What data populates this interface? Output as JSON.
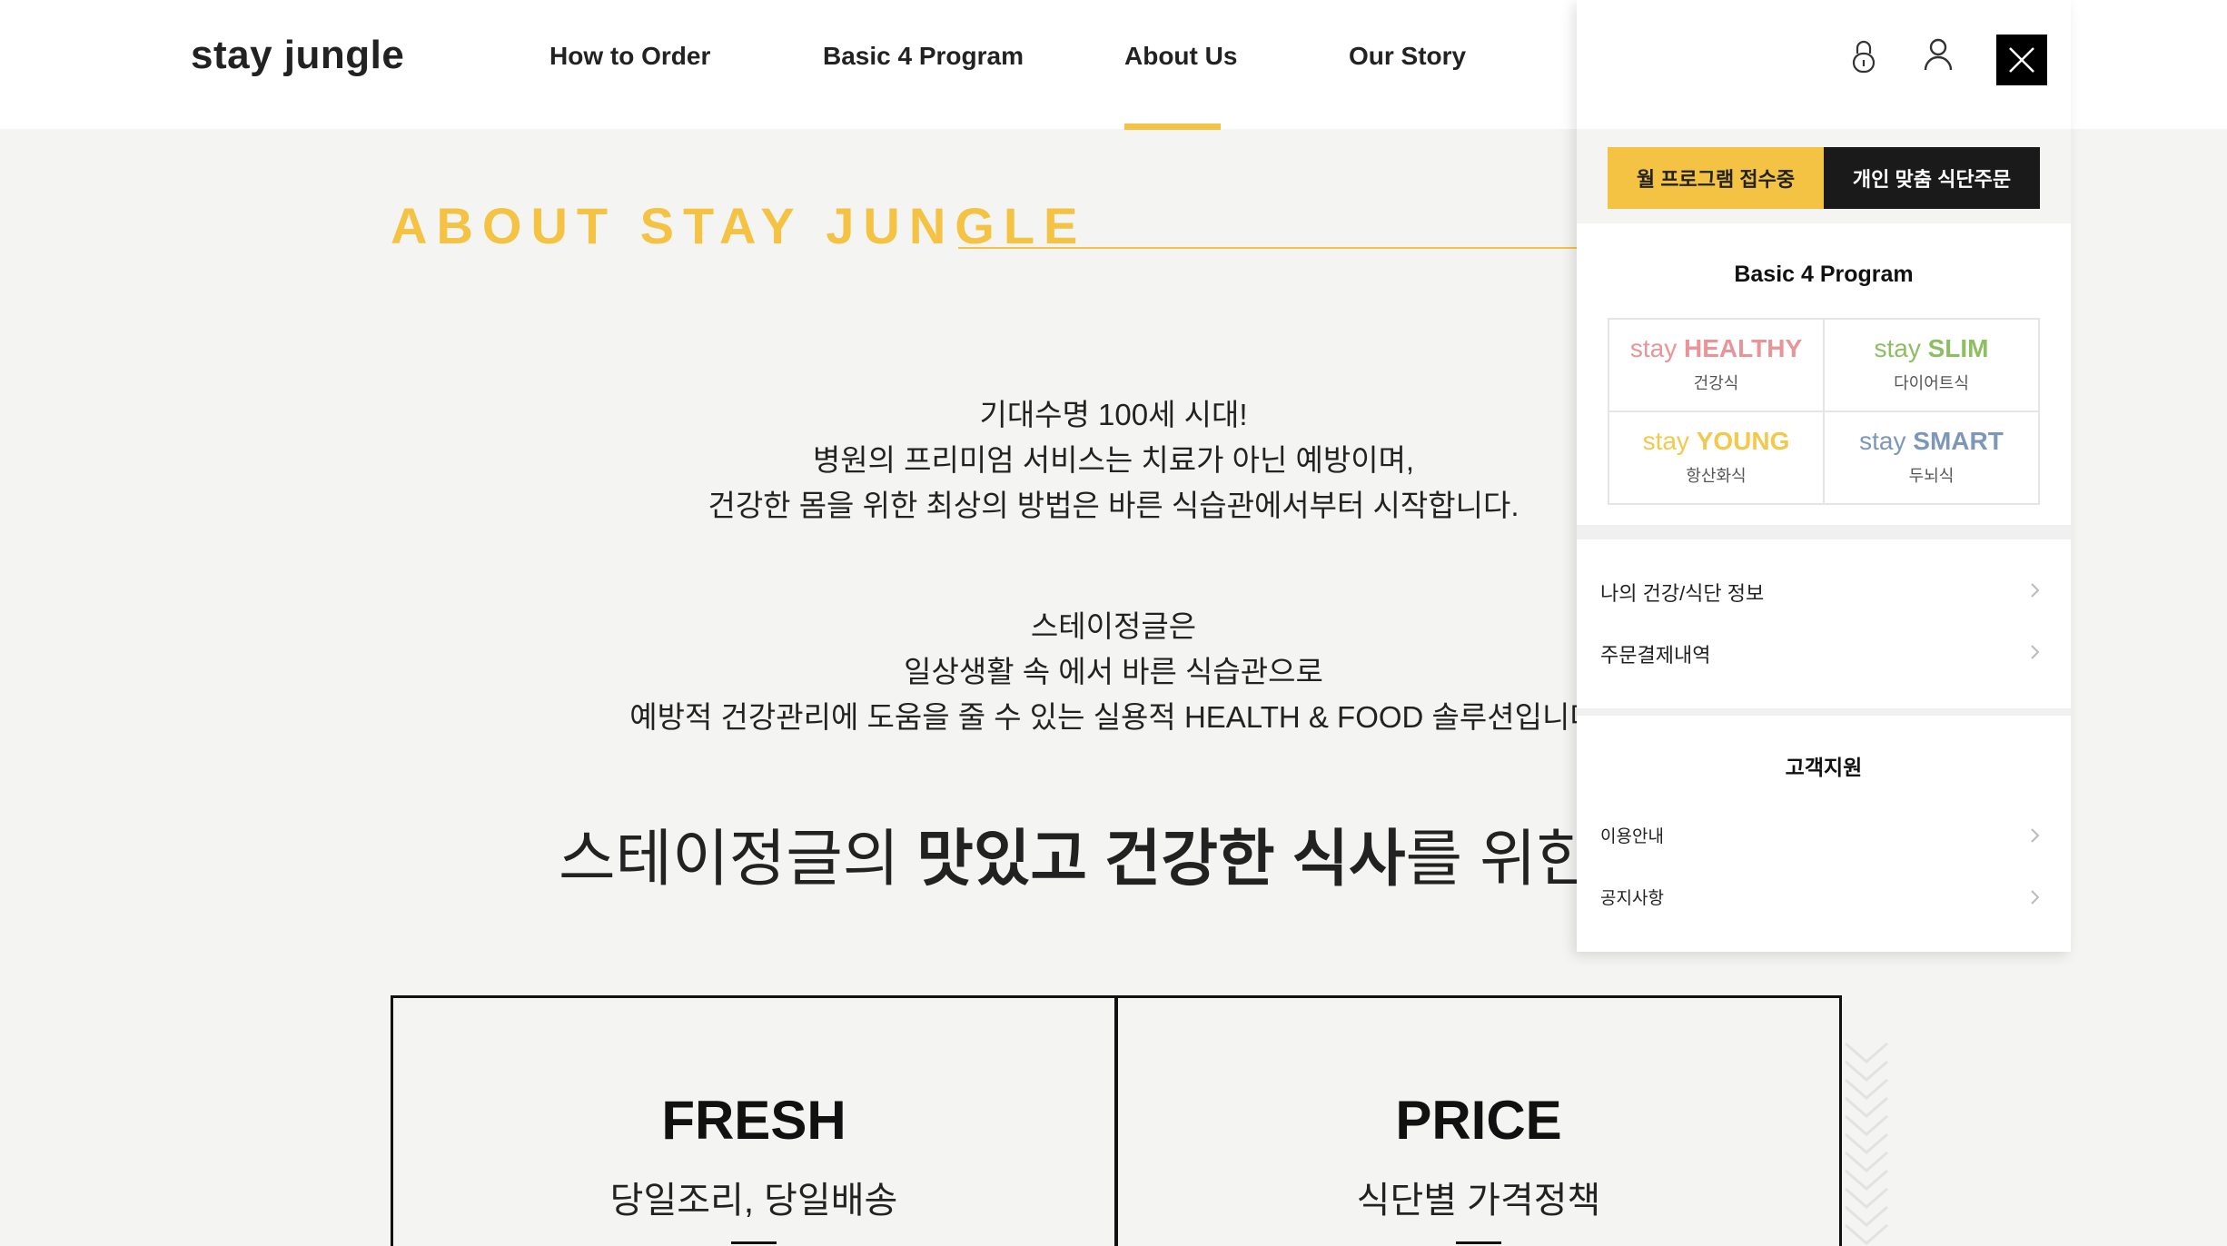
{
  "header": {
    "logo": "stay jungle",
    "nav": [
      "How to Order",
      "Basic 4 Program",
      "About Us",
      "Our Story"
    ]
  },
  "main": {
    "section_title": "ABOUT STAY JUNGLE",
    "para1": [
      "기대수명 100세 시대!",
      "병원의 프리미엄 서비스는 치료가 아닌 예방이며,",
      "건강한 몸을 위한 최상의 방법은 바른 식습관에서부터 시작합니다."
    ],
    "para2": [
      "스테이정글은",
      "일상생활 속 에서 바른 식습관으로",
      "예방적 건강관리에 도움을 줄 수 있는 실용적 HEALTH & FOOD 솔루션입니다"
    ],
    "big_line": {
      "pre": "스테이정글의 ",
      "bold": "맛있고 건강한 식사",
      "post": "를 위한 노"
    },
    "boxes": [
      {
        "title": "FRESH",
        "sub": "당일조리, 당일배송"
      },
      {
        "title": "PRICE",
        "sub": "식단별 가격정책"
      }
    ]
  },
  "panel": {
    "btn_monthly": "월 프로그램 접수중",
    "btn_custom": "개인 맞춤 식단주문",
    "program_title": "Basic 4 Program",
    "programs": [
      {
        "stay": "stay ",
        "name": "HEALTHY",
        "sub": "건강식",
        "color": "#e8959a"
      },
      {
        "stay": "stay ",
        "name": "SLIM",
        "sub": "다이어트식",
        "color": "#8dbf62"
      },
      {
        "stay": "stay ",
        "name": "YOUNG",
        "sub": "항산화식",
        "color": "#f2c94c"
      },
      {
        "stay": "stay ",
        "name": "SMART",
        "sub": "두뇌식",
        "color": "#7d97b8"
      }
    ],
    "account_menu": [
      "나의 건강/식단 정보",
      "주문결제내역"
    ],
    "support_title": "고객지원",
    "support_menu": [
      "이용안내",
      "공지사항"
    ]
  },
  "colors": {
    "accent": "#f5c343",
    "dark": "#1a1a1a"
  }
}
